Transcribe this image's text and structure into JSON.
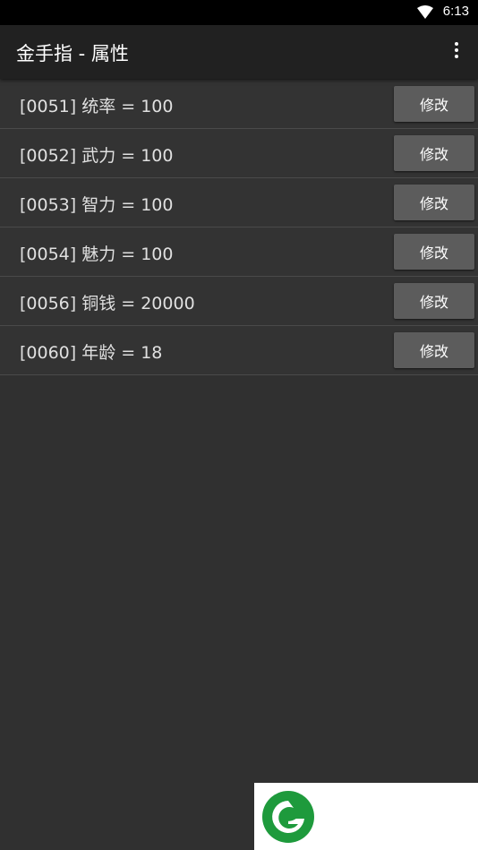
{
  "status_bar": {
    "time": "6:13",
    "icons": [
      "wifi-icon"
    ]
  },
  "app_bar": {
    "title": "金手指 - 属性",
    "menu_icon": "overflow-menu-icon"
  },
  "rows": [
    {
      "label": "[0051] 统率 = 100",
      "button": "修改"
    },
    {
      "label": "[0052] 武力 = 100",
      "button": "修改"
    },
    {
      "label": "[0053] 智力 = 100",
      "button": "修改"
    },
    {
      "label": "[0054] 魅力 = 100",
      "button": "修改"
    },
    {
      "label": "[0056] 铜钱 = 20000",
      "button": "修改"
    },
    {
      "label": "[0060] 年龄 = 18",
      "button": "修改"
    }
  ],
  "colors": {
    "background": "#303030",
    "app_bar": "#212121",
    "button": "#5c5c5c",
    "logo_green": "#1e9a3c"
  }
}
